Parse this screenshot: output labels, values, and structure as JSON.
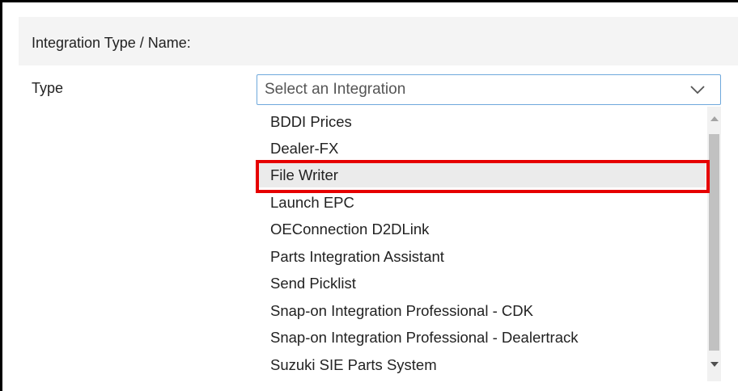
{
  "section": {
    "title": "Integration Type / Name:"
  },
  "type_field": {
    "label": "Type",
    "selected_value": "Select an Integration",
    "options": [
      "BDDI Prices",
      "Dealer-FX",
      "File Writer",
      "Launch EPC",
      "OEConnection D2DLink",
      "Parts Integration Assistant",
      "Send Picklist",
      "Snap-on Integration Professional - CDK",
      "Snap-on Integration Professional - Dealertrack",
      "Suzuki SIE Parts System"
    ],
    "highlighted_option": "File Writer"
  },
  "colors": {
    "focus_border": "#6ea8dc",
    "highlight_annotation": "#e60000",
    "header_background": "#f4f4f4"
  },
  "icons": {
    "select_toggle": "chevron-down-icon",
    "scroll_up": "triangle-up-icon",
    "scroll_down": "triangle-down-icon"
  }
}
